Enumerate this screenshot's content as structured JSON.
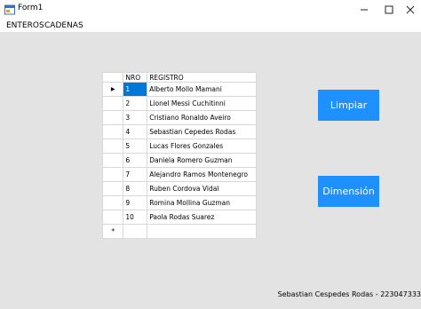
{
  "window": {
    "title": "Form1"
  },
  "menu": {
    "items": [
      "ENTEROS",
      "CADENAS"
    ]
  },
  "grid": {
    "columns": [
      "NRO",
      "REGISTRO"
    ],
    "rows": [
      {
        "nro": "1",
        "registro": "Alberto Mollo Mamani"
      },
      {
        "nro": "2",
        "registro": "Lionel Messi Cuchitinni"
      },
      {
        "nro": "3",
        "registro": "Cristiano Ronaldo Aveiro"
      },
      {
        "nro": "4",
        "registro": "Sebastian Cepedes Rodas"
      },
      {
        "nro": "5",
        "registro": "Lucas Flores Gonzales"
      },
      {
        "nro": "6",
        "registro": "Daniela Romero Guzman"
      },
      {
        "nro": "7",
        "registro": "Alejandro Ramos Montenegro"
      },
      {
        "nro": "8",
        "registro": "Ruben Cordova Vidal"
      },
      {
        "nro": "9",
        "registro": "Romina Mollina Guzman"
      },
      {
        "nro": "10",
        "registro": "Paola Rodas Suarez"
      }
    ],
    "current_row_marker": "▶",
    "new_row_marker": "*"
  },
  "buttons": {
    "limpiar": "Limpiar",
    "dimension": "Dimensión"
  },
  "status": {
    "text": "Sebastian Cespedes Rodas - 223047333"
  },
  "colors": {
    "accent": "#1e90ff",
    "selection": "#0078d7"
  }
}
